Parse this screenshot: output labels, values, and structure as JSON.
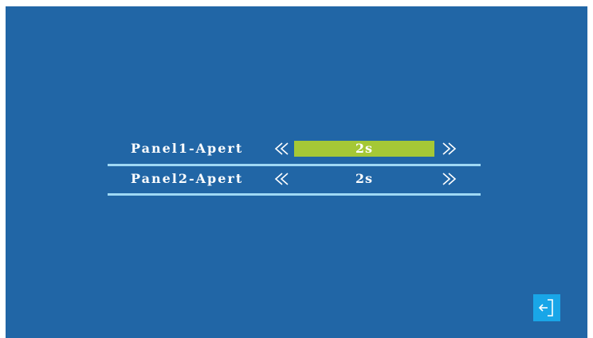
{
  "rows": [
    {
      "label": "Panel1-Apert",
      "value": "2s",
      "selected": true
    },
    {
      "label": "Panel2-Apert",
      "value": "2s",
      "selected": false
    }
  ],
  "icons": {
    "decrease": "double-chevron-left-icon",
    "increase": "double-chevron-right-icon",
    "exit": "exit-icon"
  },
  "colors": {
    "background": "#2166a6",
    "selected_value": "#a5c836",
    "divider": "#9fd9f5",
    "exit_button": "#19a6e8",
    "text": "#ffffff"
  }
}
